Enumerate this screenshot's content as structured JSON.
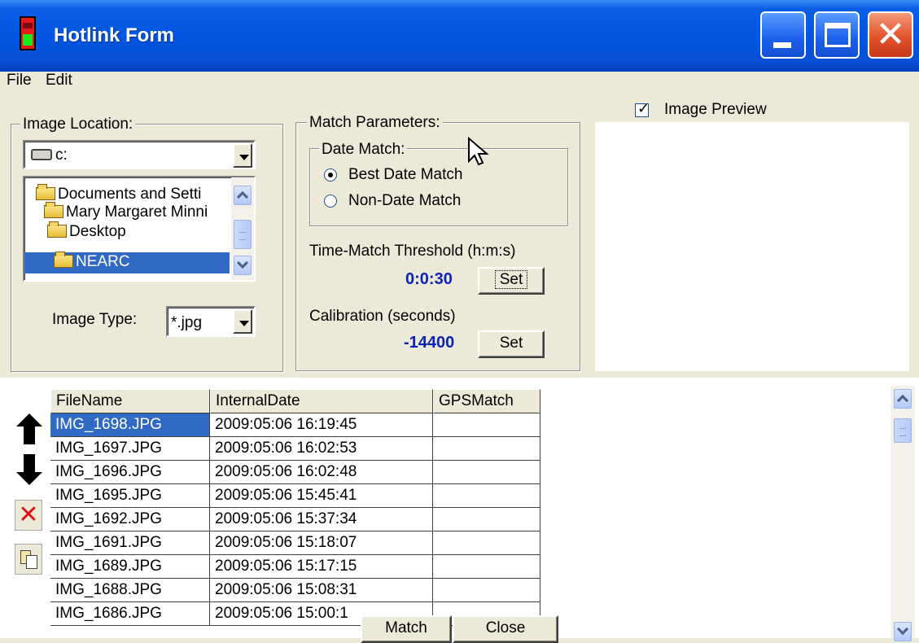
{
  "window": {
    "title": "Hotlink Form"
  },
  "menu": [
    "File",
    "Edit"
  ],
  "image_location": {
    "label": "Image Location:",
    "drive": "c:",
    "folders": [
      "Documents and Setti",
      "Mary Margaret Minni",
      "Desktop",
      "NEARC"
    ],
    "selected_folder": "NEARC",
    "image_type_label": "Image Type:",
    "image_type": "*.jpg"
  },
  "match_params": {
    "label": "Match Parameters:",
    "date_match_label": "Date Match:",
    "best_date": "Best Date Match",
    "non_date": "Non-Date Match",
    "selected": "Best Date Match",
    "threshold_label": "Time-Match Threshold (h:m:s)",
    "threshold_value": "0:0:30",
    "set_label": "Set",
    "calibration_label": "Calibration (seconds)",
    "calibration_value": "-14400",
    "set_label2": "Set"
  },
  "preview": {
    "label": "Image Preview",
    "checked": true
  },
  "grid": {
    "columns": [
      "FileName",
      "InternalDate",
      "GPSMatch"
    ],
    "rows": [
      [
        "IMG_1698.JPG",
        "2009:05:06 16:19:45",
        ""
      ],
      [
        "IMG_1697.JPG",
        "2009:05:06 16:02:53",
        ""
      ],
      [
        "IMG_1696.JPG",
        "2009:05:06 16:02:48",
        ""
      ],
      [
        "IMG_1695.JPG",
        "2009:05:06 15:45:41",
        ""
      ],
      [
        "IMG_1692.JPG",
        "2009:05:06 15:37:34",
        ""
      ],
      [
        "IMG_1691.JPG",
        "2009:05:06 15:18:07",
        ""
      ],
      [
        "IMG_1689.JPG",
        "2009:05:06 15:17:15",
        ""
      ],
      [
        "IMG_1688.JPG",
        "2009:05:06 15:08:31",
        ""
      ],
      [
        "IMG_1686.JPG",
        "2009:05:06 15:00:1",
        ""
      ]
    ],
    "selected_row": 0
  },
  "buttons": {
    "match": "Match",
    "close": "Close"
  },
  "side_tools": [
    "arrow-up-icon",
    "arrow-down-icon",
    "delete-icon",
    "copy-icon"
  ]
}
